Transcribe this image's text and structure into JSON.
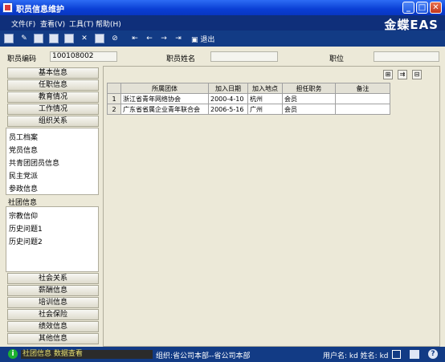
{
  "window": {
    "title": "职员信息维护"
  },
  "menu": [
    {
      "label": "文件(F)"
    },
    {
      "label": "查看(V)"
    },
    {
      "label": "工具(T)"
    },
    {
      "label": "帮助(H)"
    }
  ],
  "brand": "金蝶EAS",
  "toolbar": {
    "exit_label": "退出"
  },
  "fields": {
    "employee_code_label": "职员编码",
    "employee_code_value": "100108002",
    "employee_name_label": "职员姓名",
    "employee_name_value": "",
    "position_label": "职位",
    "position_value": ""
  },
  "tabs_top": [
    {
      "label": "基本信息"
    },
    {
      "label": "任职信息"
    },
    {
      "label": "教育情况"
    },
    {
      "label": "工作情况"
    },
    {
      "label": "组织关系"
    }
  ],
  "org_panel_items": [
    {
      "label": "员工档案"
    },
    {
      "label": "党员信息"
    },
    {
      "label": "共青团团员信息"
    },
    {
      "label": "民主党派"
    },
    {
      "label": "参政信息"
    }
  ],
  "selected_sub": "社团信息",
  "sub_panel_items": [
    {
      "label": "宗教信仰"
    },
    {
      "label": "历史问题1"
    },
    {
      "label": "历史问题2"
    }
  ],
  "tabs_bottom": [
    {
      "label": "社会关系"
    },
    {
      "label": "薪酬信息"
    },
    {
      "label": "培训信息"
    },
    {
      "label": "社会保险"
    },
    {
      "label": "绩效信息"
    },
    {
      "label": "其他信息"
    }
  ],
  "table": {
    "headers": [
      "",
      "所属团体",
      "加入日期",
      "加入地点",
      "担任职务",
      "备注"
    ],
    "rows": [
      [
        "1",
        "浙江省青年网络协会",
        "2000-4-10",
        "杭州",
        "会员",
        ""
      ],
      [
        "2",
        "广东省省属企业青年联合会",
        "2006-5-16",
        "广州",
        "会员",
        ""
      ]
    ]
  },
  "status": {
    "message": "社团信息 数据查看",
    "org": "组织:省公司本部--省公司本部",
    "user": "用户名: kd 姓名: kd"
  }
}
